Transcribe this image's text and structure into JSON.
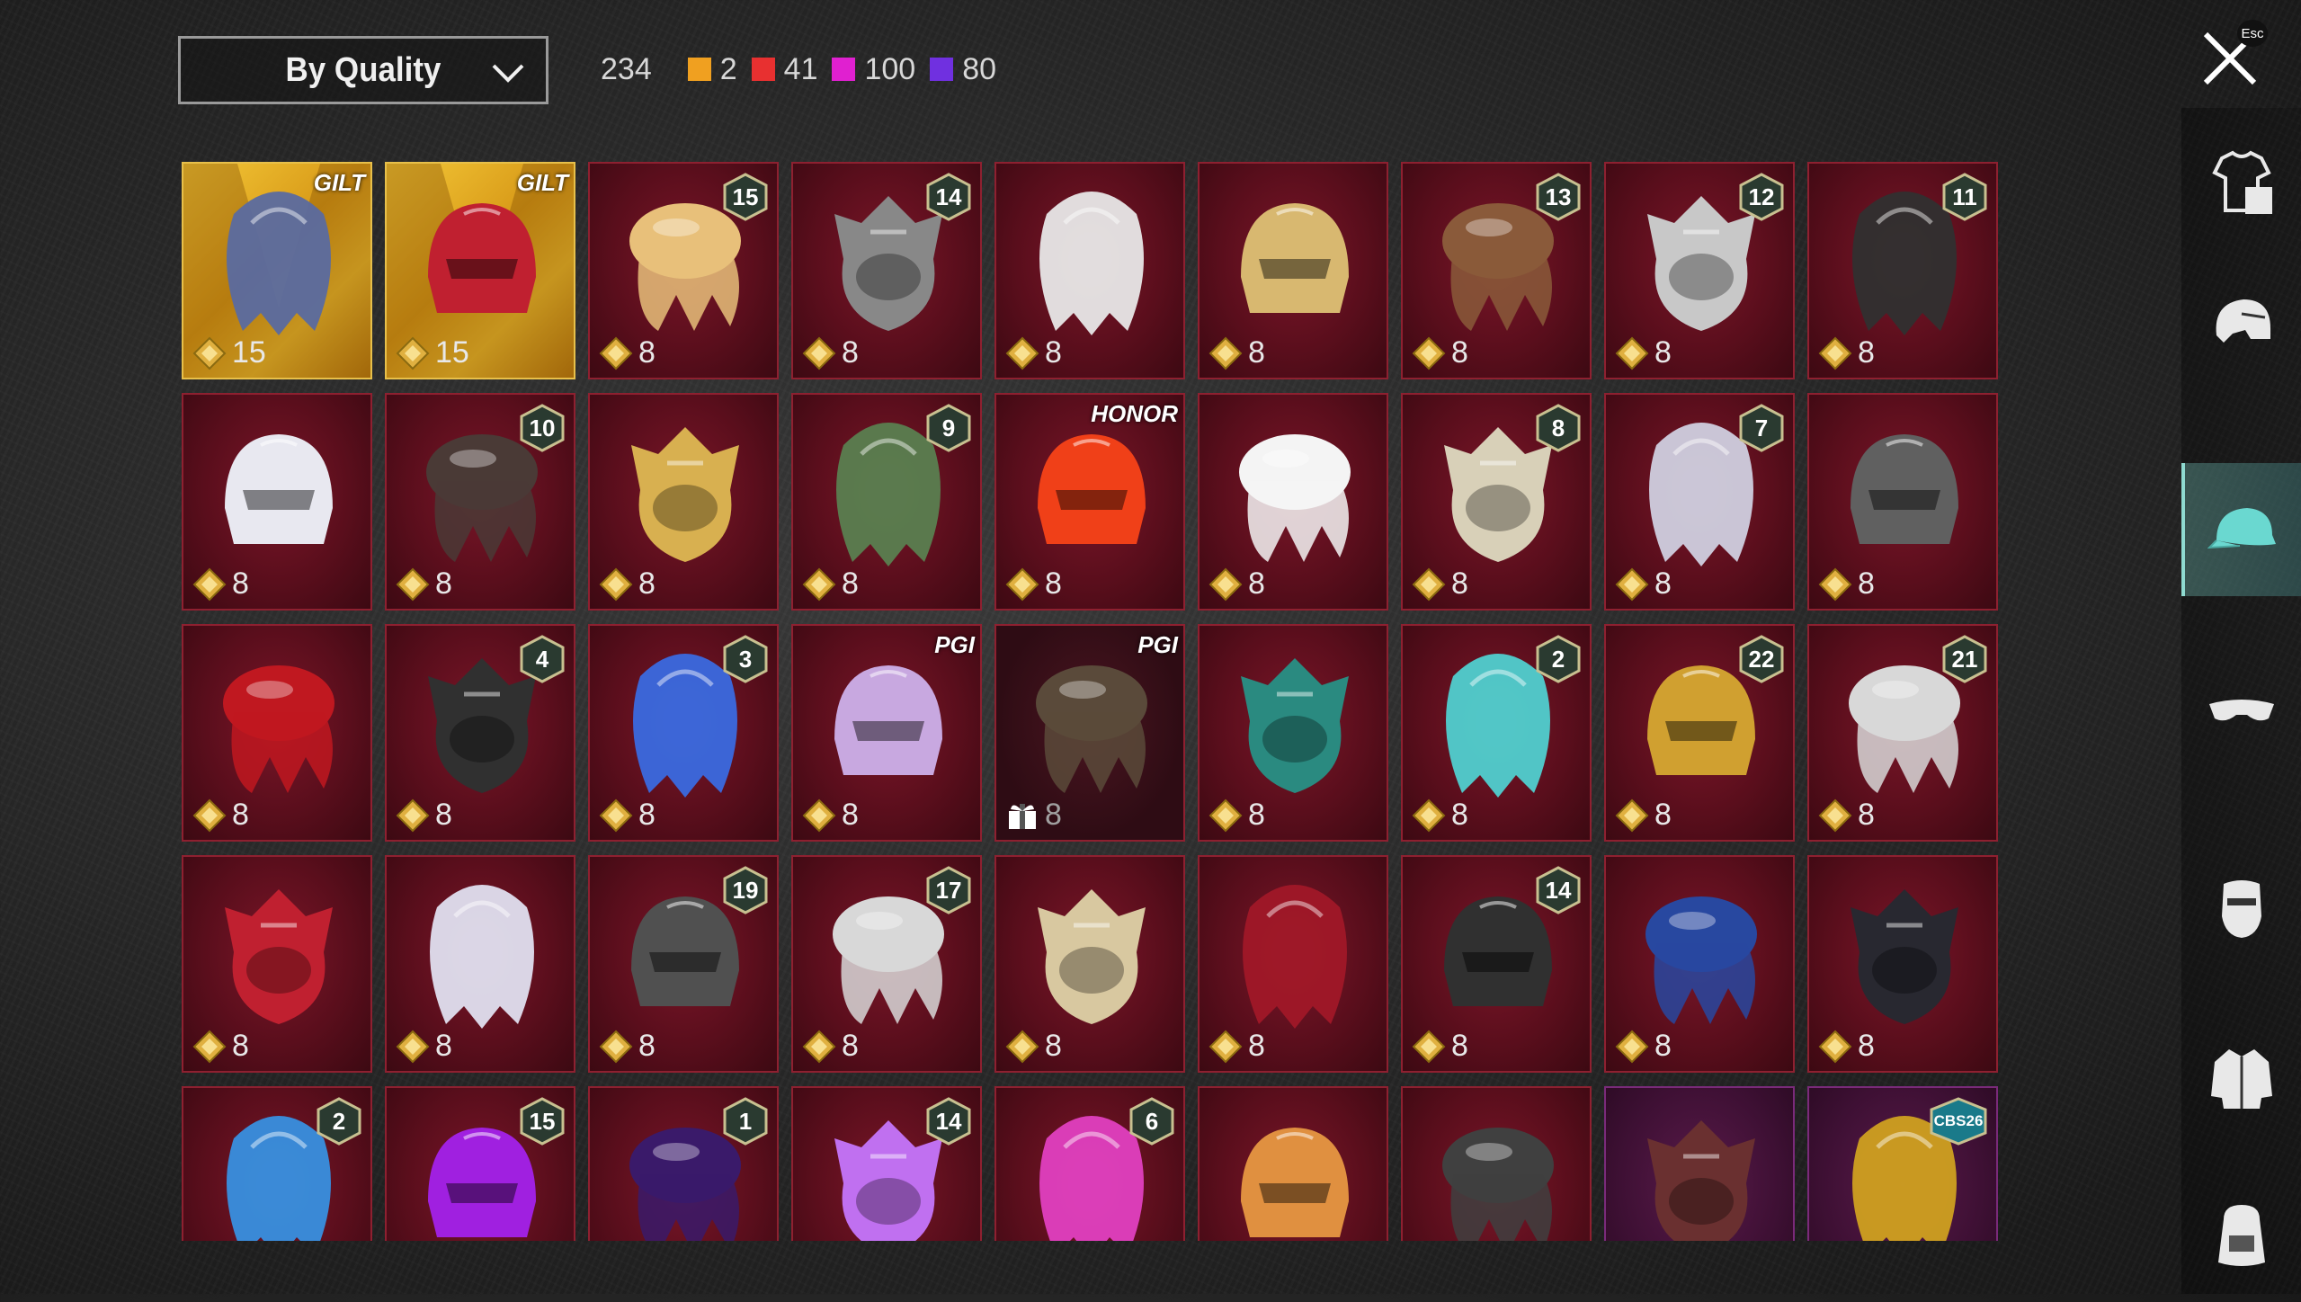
{
  "filter": {
    "label": "By Quality"
  },
  "counts": {
    "total": "234",
    "items": [
      {
        "color": "#f0a020",
        "value": "2"
      },
      {
        "color": "#e83030",
        "value": "41"
      },
      {
        "color": "#e020d0",
        "value": "100"
      },
      {
        "color": "#7030e0",
        "value": "80"
      }
    ]
  },
  "close": {
    "esc_label": "Esc"
  },
  "sidebar": [
    {
      "icon": "outfit-icon",
      "active": false
    },
    {
      "icon": "helmet-icon",
      "active": false
    },
    {
      "icon": "cap-icon",
      "active": true
    },
    {
      "icon": "glasses-icon",
      "active": false
    },
    {
      "icon": "mask-icon",
      "active": false
    },
    {
      "icon": "jacket-icon",
      "active": false
    },
    {
      "icon": "backpack-icon",
      "active": false
    }
  ],
  "items": [
    {
      "name": "gilt-blue-headdress",
      "cost": "15",
      "style": "gold",
      "tag": "GILT",
      "color": "#5a6aa0"
    },
    {
      "name": "gilt-red-helmet",
      "cost": "15",
      "style": "gold",
      "tag": "GILT",
      "color": "#c02030"
    },
    {
      "name": "blonde-pink-hair",
      "cost": "8",
      "badge": "15",
      "color": "#e8c07a"
    },
    {
      "name": "cat-ear-mask",
      "cost": "8",
      "badge": "14",
      "color": "#888888"
    },
    {
      "name": "white-horned-hair",
      "cost": "8",
      "color": "#e8e8e8"
    },
    {
      "name": "blonde-horned-hair",
      "cost": "8",
      "color": "#d8b870"
    },
    {
      "name": "pirate-hat-hair",
      "cost": "8",
      "badge": "13",
      "color": "#8a5a3a"
    },
    {
      "name": "silver-bun-hair",
      "cost": "8",
      "badge": "12",
      "color": "#c8c8c8"
    },
    {
      "name": "black-streak-hair",
      "cost": "8",
      "badge": "11",
      "color": "#303030"
    },
    {
      "name": "ghost-hood",
      "cost": "8",
      "color": "#e8e8f0"
    },
    {
      "name": "dark-wavy-hair",
      "cost": "8",
      "badge": "10",
      "color": "#4a3a36"
    },
    {
      "name": "skull-visor-hair",
      "cost": "8",
      "color": "#d8b050"
    },
    {
      "name": "green-face-hair",
      "cost": "8",
      "badge": "9",
      "color": "#5a8050"
    },
    {
      "name": "orange-flame-hair",
      "cost": "8",
      "tag": "HONOR",
      "color": "#f04018"
    },
    {
      "name": "white-cowboy-hat",
      "cost": "8",
      "color": "#f4f4f4"
    },
    {
      "name": "winged-blonde-hair",
      "cost": "8",
      "badge": "8",
      "color": "#d8d0b8"
    },
    {
      "name": "silver-long-hair",
      "cost": "8",
      "badge": "7",
      "color": "#d0d0e0"
    },
    {
      "name": "oni-mask-hair",
      "cost": "8",
      "color": "#606060"
    },
    {
      "name": "red-knight-helmet",
      "cost": "8",
      "color": "#c01820"
    },
    {
      "name": "snowman-top-hat",
      "cost": "8",
      "badge": "4",
      "color": "#303030"
    },
    {
      "name": "clown-blue-hair",
      "cost": "8",
      "badge": "3",
      "color": "#3a6ae0"
    },
    {
      "name": "lilac-twin-hair",
      "cost": "8",
      "tag": "PGI",
      "color": "#c8a8e0"
    },
    {
      "name": "samurai-kabuto",
      "cost": "8",
      "tag": "PGI",
      "style": "dark",
      "gift": true,
      "color": "#5a4a3a"
    },
    {
      "name": "dragon-crest-helmet",
      "cost": "8",
      "color": "#2a8a80"
    },
    {
      "name": "aqua-diver-helmet",
      "cost": "8",
      "badge": "2",
      "color": "#50d0d0"
    },
    {
      "name": "gold-pharaoh-crown",
      "cost": "8",
      "badge": "22",
      "color": "#d0a030"
    },
    {
      "name": "joker-mask-hair",
      "cost": "8",
      "badge": "21",
      "color": "#d8d8d8"
    },
    {
      "name": "red-demon-mask",
      "cost": "8",
      "color": "#c02030"
    },
    {
      "name": "white-ponytail",
      "cost": "8",
      "color": "#e0e0f0"
    },
    {
      "name": "iron-visor-helmet",
      "cost": "8",
      "badge": "19",
      "color": "#505050"
    },
    {
      "name": "silver-sidetail",
      "cost": "8",
      "badge": "17",
      "color": "#d8d8d8"
    },
    {
      "name": "veiled-headdress",
      "cost": "8",
      "color": "#d8c8a0"
    },
    {
      "name": "crimson-cyber-helmet",
      "cost": "8",
      "color": "#a01828"
    },
    {
      "name": "horned-nun-veil",
      "cost": "8",
      "badge": "14",
      "color": "#303030"
    },
    {
      "name": "blue-feather-hair",
      "cost": "8",
      "color": "#2848a0"
    },
    {
      "name": "bat-knight-helmet",
      "cost": "8",
      "color": "#282830"
    },
    {
      "name": "samurai-mecha-helmet",
      "badge": "2",
      "color": "#3890e0"
    },
    {
      "name": "purple-neon-helmet",
      "badge": "15",
      "color": "#a020e0"
    },
    {
      "name": "dark-violet-helmet",
      "badge": "1",
      "color": "#3a1a6a"
    },
    {
      "name": "lavender-curly-hair",
      "badge": "14",
      "color": "#c070f0"
    },
    {
      "name": "pink-tv-head",
      "badge": "6",
      "color": "#e040c0"
    },
    {
      "name": "shiba-mask",
      "color": "#e09040"
    },
    {
      "name": "black-white-helmet",
      "color": "#404040"
    },
    {
      "name": "auburn-hair",
      "style": "purple",
      "color": "#6a3030"
    },
    {
      "name": "golden-creature-hat",
      "style": "purple",
      "badge": "CBS26",
      "color": "#d0a020"
    }
  ]
}
